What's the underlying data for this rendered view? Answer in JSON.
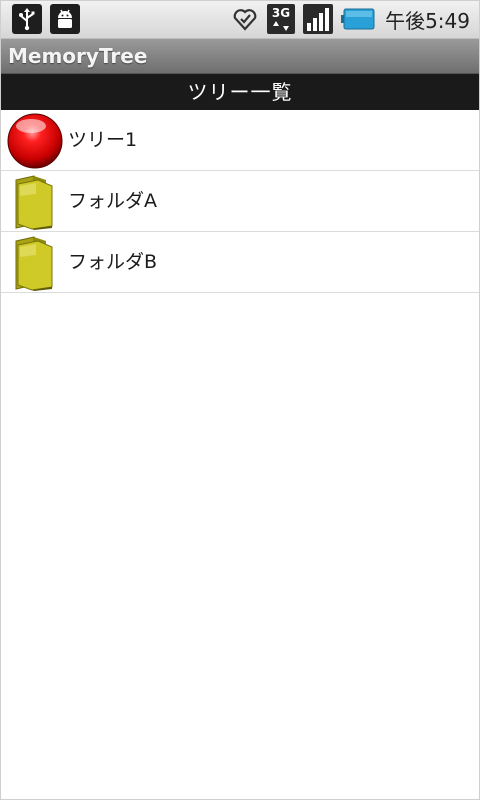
{
  "status_bar": {
    "left_icons": [
      "usb-icon",
      "android-debug-icon"
    ],
    "right_icons": [
      "sync-icon",
      "network-3g-icon",
      "signal-icon",
      "battery-icon"
    ],
    "network_label": "3G",
    "clock": "午後5:49"
  },
  "app": {
    "title": "MemoryTree"
  },
  "header": {
    "title": "ツリー一覧"
  },
  "list": {
    "items": [
      {
        "label": "ツリー1",
        "icon": "red-ball-icon"
      },
      {
        "label": "フォルダA",
        "icon": "folder-icon"
      },
      {
        "label": "フォルダB",
        "icon": "folder-icon"
      }
    ]
  },
  "colors": {
    "header_bg": "#1a1a1a",
    "title_bar_bg": "#808080",
    "status_bar_bg": "#e4e4e4",
    "folder": "#c8c418",
    "tree_ball": "#e00000",
    "battery": "#2aa0d8"
  }
}
